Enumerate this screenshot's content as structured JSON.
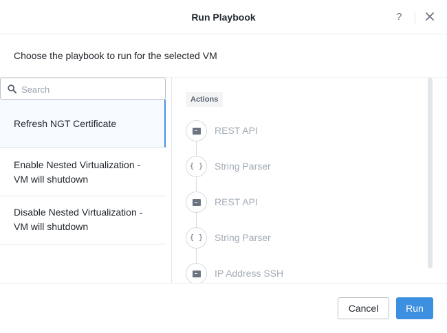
{
  "dialog": {
    "title": "Run Playbook",
    "help_label": "?",
    "subtitle": "Choose the playbook to run for the selected VM"
  },
  "search": {
    "placeholder": "Search",
    "value": ""
  },
  "playbooks": [
    {
      "label": "Refresh NGT Certificate",
      "selected": true
    },
    {
      "label": "Enable Nested Virtualization - VM will shutdown",
      "selected": false
    },
    {
      "label": "Disable Nested Virtualization - VM will shutdown",
      "selected": false
    }
  ],
  "actions": {
    "header": "Actions",
    "steps": [
      {
        "label": "REST API",
        "icon": "terminal-icon"
      },
      {
        "label": "String Parser",
        "icon": "braces-icon"
      },
      {
        "label": "REST API",
        "icon": "terminal-icon"
      },
      {
        "label": "String Parser",
        "icon": "braces-icon"
      },
      {
        "label": "IP Address SSH",
        "icon": "terminal-icon"
      }
    ]
  },
  "footer": {
    "cancel_label": "Cancel",
    "run_label": "Run"
  },
  "colors": {
    "accent": "#3d8fe0",
    "selected_border": "#4a90d9",
    "muted_text": "#a3abb5"
  }
}
